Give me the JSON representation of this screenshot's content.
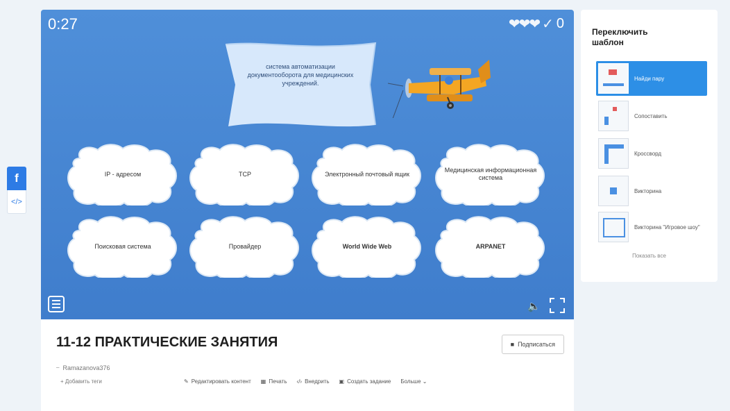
{
  "social": {
    "fb_label": "f",
    "embed_label": "</>"
  },
  "game": {
    "timer": "0:27",
    "lives": "❤❤❤",
    "score_check": "✓",
    "score": "0",
    "question": "система автоматизации документооборота для медицинских учреждений.",
    "answers": [
      {
        "label": "IP - адресом",
        "bold": false
      },
      {
        "label": "TCP",
        "bold": false
      },
      {
        "label": "Электронный почтовый ящик",
        "bold": false
      },
      {
        "label": "Медицинская информационная система",
        "bold": false
      },
      {
        "label": "Поисковая система",
        "bold": false
      },
      {
        "label": "Провайдер",
        "bold": false
      },
      {
        "label": "World Wide Web",
        "bold": true
      },
      {
        "label": "ARPANET",
        "bold": true
      }
    ],
    "sound_glyph": "🔈"
  },
  "info": {
    "title": "11-12 ПРАКТИЧЕСКИЕ ЗАНЯТИЯ",
    "subscribe_label": "Подписаться",
    "author": "Ramazanova376",
    "add_tags": "+ Добавить теги",
    "toolbar": [
      {
        "icon": "pencil-icon",
        "label": "Редактировать контент"
      },
      {
        "icon": "print-icon",
        "label": "Печать"
      },
      {
        "icon": "embed-icon",
        "label": "Внедрить"
      },
      {
        "icon": "assignment-icon",
        "label": "Создать задание"
      },
      {
        "icon": "",
        "label": "Больше ⌄"
      }
    ]
  },
  "switcher": {
    "title": "Переключить шаблон",
    "templates": [
      {
        "label": "Найди пару",
        "active": true
      },
      {
        "label": "Сопоставить",
        "active": false
      },
      {
        "label": "Кроссворд",
        "active": false
      },
      {
        "label": "Викторина",
        "active": false
      },
      {
        "label": "Викторина \"Игровое шоу\"",
        "active": false
      }
    ],
    "show_all": "Показать все"
  },
  "colors": {
    "accent": "#2d8fe6",
    "game_bg": "#4a8bd6",
    "facebook": "#2d7be5"
  }
}
